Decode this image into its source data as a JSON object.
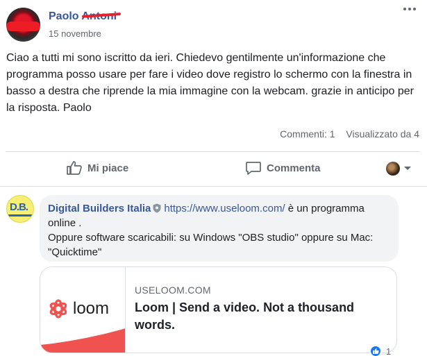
{
  "post": {
    "author_visible": "Paolo ",
    "author_redacted": "Antoni",
    "date": "15 novembre",
    "text": "Ciao a tutti mi sono iscritto da ieri. Chiedevo gentilmente un'informazione che programma posso usare per fare i video dove registro lo schermo con la finestra in basso a destra che riprende la mia immagine con la webcam. grazie in anticipo per la risposta. Paolo",
    "comments_count": "Commenti: 1",
    "views_count": "Visualizzato da 4"
  },
  "actions": {
    "like_label": "Mi piace",
    "comment_label": "Commenta"
  },
  "comment": {
    "avatar_text": "D.B.",
    "author": "Digital Builders Italia",
    "link_text": "https://www.useloom.com/",
    "line1_rest": " è un programma online .",
    "line2": "Oppure software scaricabili: su Windows \"OBS studio\" oppure su Mac: \"Quicktime\"",
    "reaction_count": "1"
  },
  "link_preview": {
    "logo_text": "loom",
    "domain": "USELOOM.COM",
    "title": "Loom | Send a video. Not a thousand words."
  },
  "colors": {
    "link_blue": "#385898",
    "loom_red": "#f0524f",
    "like_blue": "#1877f2"
  },
  "icons": {
    "like": "thumbs-up-icon",
    "comment": "speech-bubble-icon",
    "menu": "more-dots-icon",
    "verified": "verified-badge-icon",
    "reaction": "like-reaction-icon"
  }
}
